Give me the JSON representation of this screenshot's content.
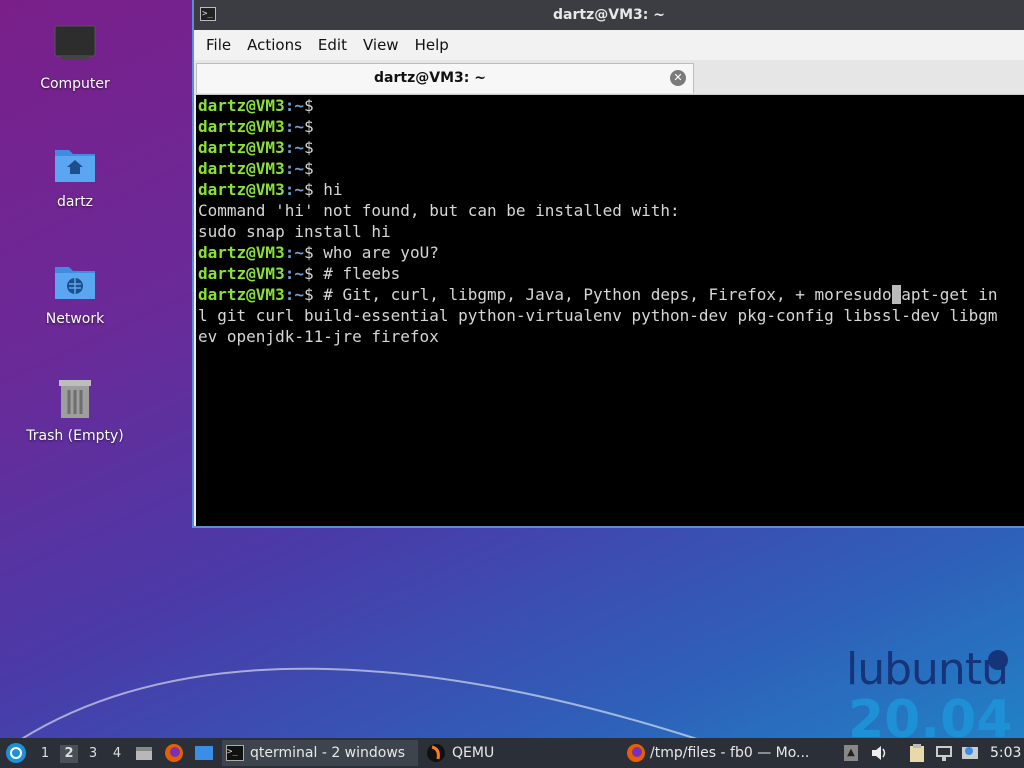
{
  "desktop": {
    "icons": [
      {
        "label": "Computer",
        "icon": "monitor-icon"
      },
      {
        "label": "dartz",
        "icon": "home-folder-icon"
      },
      {
        "label": "Network",
        "icon": "network-folder-icon"
      },
      {
        "label": "Trash (Empty)",
        "icon": "trash-icon"
      }
    ]
  },
  "window": {
    "title": "dartz@VM3: ~",
    "menu": [
      "File",
      "Actions",
      "Edit",
      "View",
      "Help"
    ],
    "tab_label": "dartz@VM3: ~",
    "prompt_user": "dartz@VM3",
    "prompt_path": ":~",
    "prompt_sym": "$",
    "lines": [
      {
        "prompt": true,
        "text": ""
      },
      {
        "prompt": true,
        "text": ""
      },
      {
        "prompt": true,
        "text": ""
      },
      {
        "prompt": true,
        "text": ""
      },
      {
        "prompt": true,
        "text": " hi"
      },
      {
        "prompt": false,
        "text": "Command 'hi' not found, but can be installed with:"
      },
      {
        "prompt": false,
        "text": "sudo snap install hi"
      },
      {
        "prompt": true,
        "text": " who are yoU?"
      },
      {
        "prompt": true,
        "text": " # fleebs"
      },
      {
        "prompt": true,
        "text": " # Git, curl, libgmp, Java, Python deps, Firefox, + moresudo",
        "cursor": " ",
        "after": "apt-get in"
      },
      {
        "prompt": false,
        "text": "l git curl build-essential python-virtualenv python-dev pkg-config libssl-dev libgm"
      },
      {
        "prompt": false,
        "text": "ev openjdk-11-jre firefox"
      }
    ]
  },
  "branding": {
    "name": "lubuntu",
    "version": "20.04"
  },
  "taskbar": {
    "workspaces": [
      "1",
      "2",
      "3",
      "4"
    ],
    "active_workspace": "2",
    "tasks": [
      {
        "label": "qterminal - 2 windows",
        "icon": "terminal-icon"
      },
      {
        "label": "QEMU",
        "icon": "qemu-icon"
      },
      {
        "label": "/tmp/files - fb0 — Mo...",
        "icon": "firefox-icon"
      }
    ],
    "clock": "5:03"
  }
}
